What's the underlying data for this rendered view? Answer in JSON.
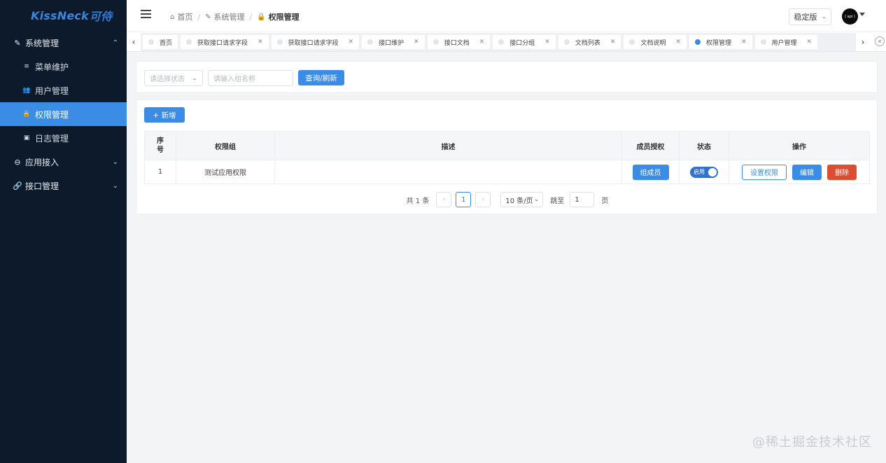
{
  "brand": {
    "name": "KissNeck",
    "accent": "可侍"
  },
  "sidebar": {
    "groups": [
      {
        "label": "系统管理",
        "icon": "wrench-icon",
        "expanded": true,
        "items": [
          {
            "label": "菜单维护",
            "icon": "list-icon"
          },
          {
            "label": "用户管理",
            "icon": "users-icon"
          },
          {
            "label": "权限管理",
            "icon": "lock-icon",
            "active": true
          },
          {
            "label": "日志管理",
            "icon": "calendar-icon"
          }
        ]
      },
      {
        "label": "应用接入",
        "icon": "minus-circle-icon",
        "expanded": false
      },
      {
        "label": "接口管理",
        "icon": "link-icon",
        "expanded": false
      }
    ]
  },
  "header": {
    "breadcrumb": [
      "首页",
      "系统管理",
      "权限管理"
    ],
    "version": "稳定版",
    "avatar_text": "( api )"
  },
  "tabs": [
    {
      "label": "首页",
      "closable": false,
      "active": false
    },
    {
      "label": "获取接口请求字段",
      "closable": true,
      "active": false
    },
    {
      "label": "获取接口请求字段",
      "closable": true,
      "active": false
    },
    {
      "label": "接口维护",
      "closable": true,
      "active": false
    },
    {
      "label": "接口文档",
      "closable": true,
      "active": false
    },
    {
      "label": "接口分组",
      "closable": true,
      "active": false
    },
    {
      "label": "文档列表",
      "closable": true,
      "active": false
    },
    {
      "label": "文档说明",
      "closable": true,
      "active": false
    },
    {
      "label": "权限管理",
      "closable": true,
      "active": true
    },
    {
      "label": "用户管理",
      "closable": true,
      "active": false
    }
  ],
  "search": {
    "status_placeholder": "请选择状态",
    "name_placeholder": "请输入组名称",
    "query_button": "查询/刷新"
  },
  "toolbar": {
    "add_button": "+ 新增"
  },
  "table": {
    "columns": [
      "序号",
      "权限组",
      "描述",
      "成员授权",
      "状态",
      "操作"
    ],
    "index_header": [
      "序",
      "号"
    ],
    "rows": [
      {
        "index": "1",
        "group": "测试应用权限",
        "desc": "",
        "members_button": "组成员",
        "status": "启用",
        "enabled": true,
        "actions": {
          "set_perm": "设置权限",
          "edit": "编辑",
          "delete": "删除"
        }
      }
    ]
  },
  "pagination": {
    "total_text": "共 1 条",
    "current_page": "1",
    "page_size": "10 条/页",
    "jump_label": "跳至",
    "jump_value": "1",
    "page_unit": "页"
  },
  "watermark": "@稀土掘金技术社区",
  "colors": {
    "sidebar_bg": "#0c1a2b",
    "primary": "#3b8ce4",
    "danger": "#dc4e32"
  }
}
